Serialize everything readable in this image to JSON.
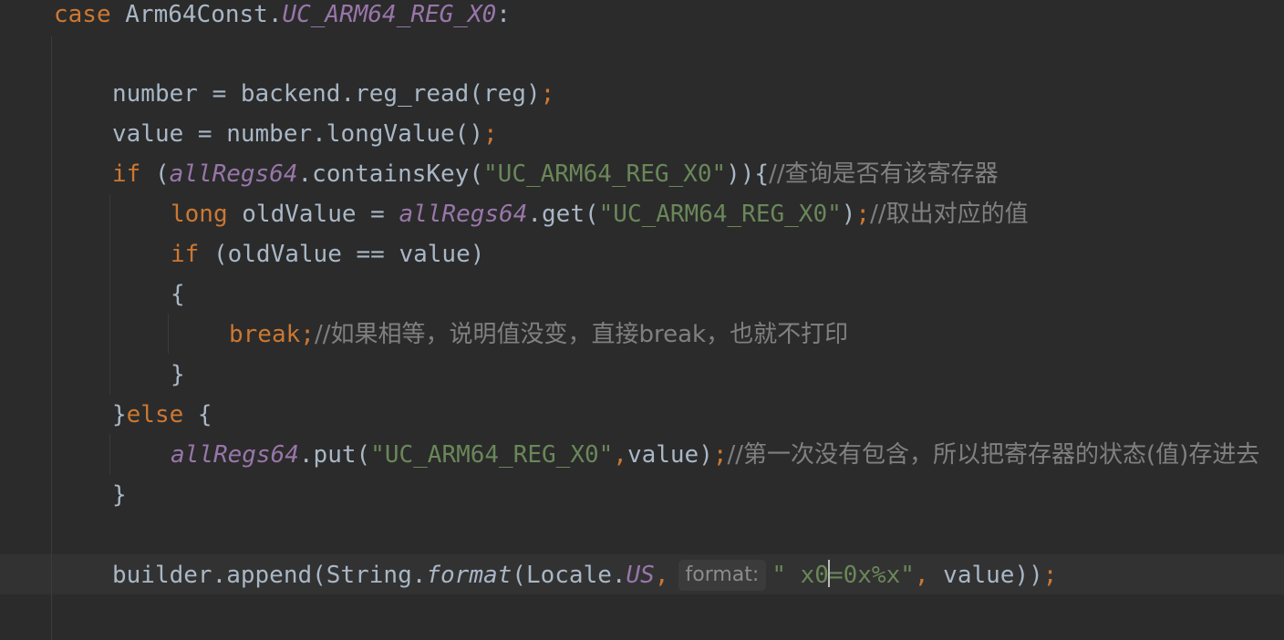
{
  "editor": {
    "lines": [
      {
        "case_kw": "case",
        "owner": "Arm64Const.",
        "const": "UC_ARM64_REG_X0",
        "colon": ":"
      },
      {},
      {
        "lhs": "number = backend.reg_read(reg)",
        "semi": ";"
      },
      {
        "lhs": "value = number.longValue()",
        "semi": ";"
      },
      {
        "if_kw": "if",
        "open": " (",
        "field": "allRegs64",
        "call": ".containsKey(",
        "str": "\"UC_ARM64_REG_X0\"",
        "close": ")){",
        "comment": "//查询是否有该寄存器"
      },
      {
        "type_kw": "long",
        "mid": " oldValue = ",
        "field": "allRegs64",
        "call": ".get(",
        "str": "\"UC_ARM64_REG_X0\"",
        "close": ")",
        "semi": ";",
        "comment": "//取出对应的值"
      },
      {
        "if_kw": "if",
        "rest": " (oldValue == value)"
      },
      {
        "brace": "{"
      },
      {
        "break_kw": "break",
        "semi": ";",
        "comment": "//如果相等，说明值没变，直接break，也就不打印"
      },
      {
        "brace": "}"
      },
      {
        "brace": "}",
        "else_kw": "else",
        "rest": " {"
      },
      {
        "field": "allRegs64",
        "call": ".put(",
        "str": "\"UC_ARM64_REG_X0\"",
        "comma": ",",
        "rest": "value)",
        "semi": ";",
        "comment": "//第一次没有包含，所以把寄存器的状态(值)存进去"
      },
      {
        "brace": "}"
      },
      {},
      {
        "pre": "builder.append(String.",
        "method": "format",
        "mid": "(Locale.",
        "const": "US",
        "comma": ",",
        "hint": "format:",
        "str_a": "\" x0",
        "str_b": "=0x%x\"",
        "comma2": ",",
        "rest": " value))",
        "semi": ";"
      }
    ]
  },
  "colors": {
    "background": "#2b2b2b",
    "keyword": "#cc7832",
    "string": "#6a8759",
    "comment": "#808080",
    "field": "#9876aa",
    "text": "#a9b7c6"
  }
}
